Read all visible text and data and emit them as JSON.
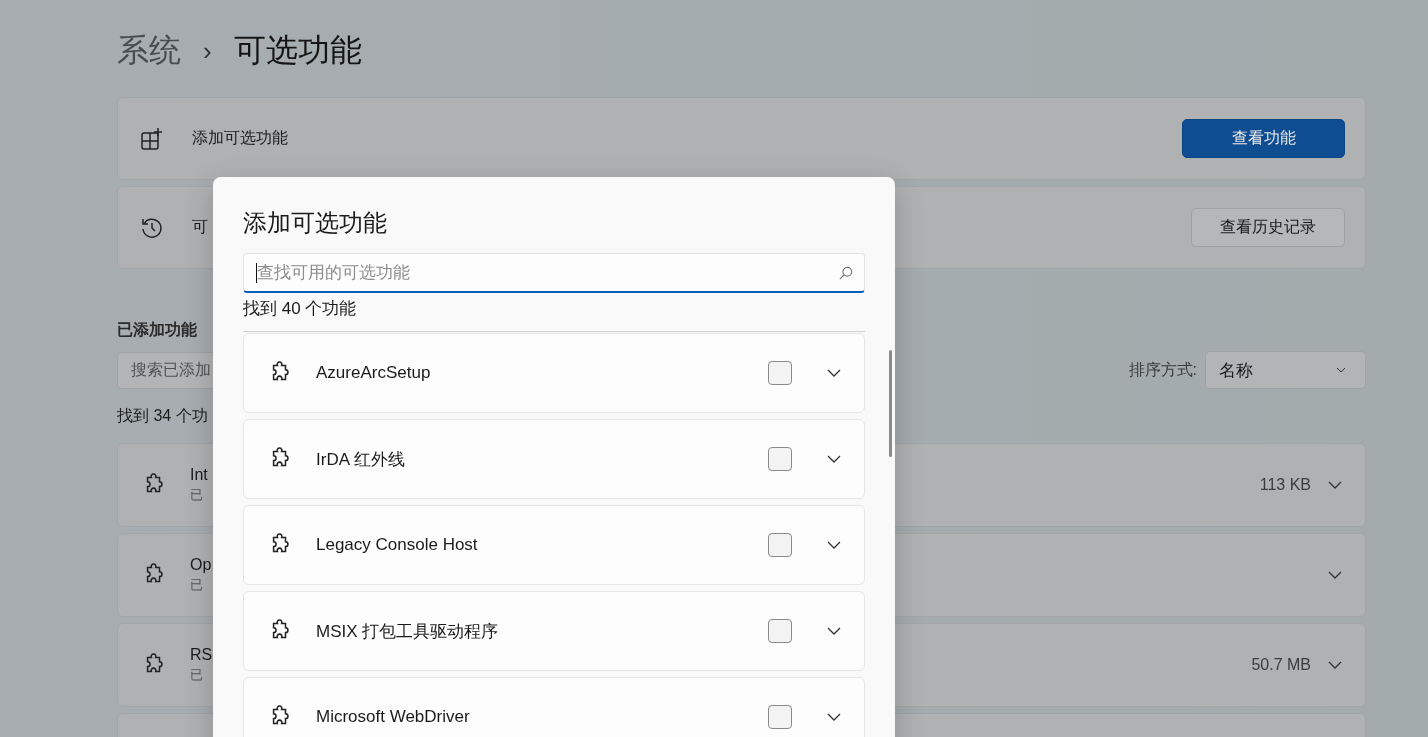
{
  "breadcrumb": {
    "parent": "系统",
    "separator": "›",
    "current": "可选功能"
  },
  "add_card": {
    "label": "添加可选功能",
    "button": "查看功能"
  },
  "history_card": {
    "label": "可",
    "button": "查看历史记录"
  },
  "installed": {
    "heading": "已添加功能",
    "search": {
      "placeholder": "搜索已添加"
    },
    "sort_label": "排序方式:",
    "sort_value": "名称",
    "count": "找到 34 个功",
    "items": [
      {
        "name": "Int",
        "status": "已",
        "size": "113 KB"
      },
      {
        "name": "Op",
        "status": "已"
      },
      {
        "name": "RS",
        "status": "已",
        "size": "50.7 MB"
      }
    ]
  },
  "dialog": {
    "title": "添加可选功能",
    "search": {
      "placeholder": "查找可用的可选功能",
      "focused": true
    },
    "count": "找到 40 个功能",
    "features": [
      {
        "name": "AzureArcSetup",
        "checked": false
      },
      {
        "name": "IrDA 红外线",
        "checked": false
      },
      {
        "name": "Legacy Console Host",
        "checked": false
      },
      {
        "name": "MSIX 打包工具驱动程序",
        "checked": false
      },
      {
        "name": "Microsoft WebDriver",
        "checked": false
      }
    ]
  }
}
